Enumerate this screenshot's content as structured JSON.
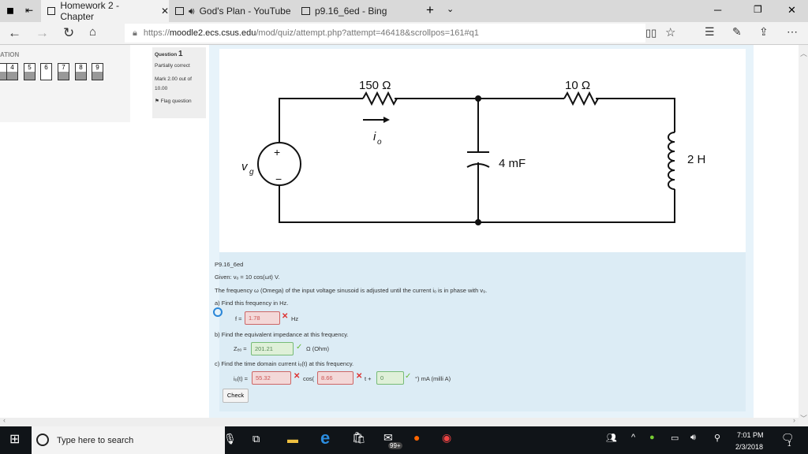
{
  "browser": {
    "tabs": [
      {
        "label": "Homework 2 - Chapter",
        "active": true
      },
      {
        "label": "God's Plan - YouTube",
        "audio": true
      },
      {
        "label": "p9.16_6ed - Bing"
      }
    ],
    "url_prefix": "https://",
    "url_host": "moodle2.ecs.csus.edu",
    "url_path": "/mod/quiz/attempt.php?attempt=46418&scrollpos=161#q1"
  },
  "nav": {
    "heading": "ATION",
    "buttons": [
      "4",
      "5",
      "6",
      "7",
      "8",
      "9"
    ]
  },
  "question_info": {
    "question_label": "Question",
    "question_number": "1",
    "status": "Partially correct",
    "mark": "Mark 2.00 out of 10.00",
    "flag": "Flag question"
  },
  "circuit": {
    "r1": "150 Ω",
    "r2": "10 Ω",
    "cap": "4 mF",
    "ind": "2 H",
    "source": "v",
    "source_sub": "g",
    "current": "i",
    "current_sub": "o",
    "plus": "+",
    "minus": "−"
  },
  "question": {
    "title": "P9.16_6ed",
    "given": "Given:  vₒ = 10 cos(ωt) V.",
    "statement": "The frequency ω (Omega) of the input voltage sinusoid is adjusted until the current iₒ is in phase with v₉.",
    "a_label": "a) Find this frequency in Hz.",
    "a_prefix": "f =",
    "a_value": "1.78",
    "a_unit": "Hz",
    "b_label": "b) Find the equivalent impedance at this frequency.",
    "b_prefix": "Zₑₒ =",
    "b_value": "201.21",
    "b_unit": "Ω (Ohm)",
    "c_label": "c) Find the time domain current iₒ(t) at this frequency.",
    "c_prefix": "iₒ(t) =",
    "c_amp": "55.32",
    "c_cos": "cos(",
    "c_freq": "8.66",
    "c_t": "t +",
    "c_phase": "0",
    "c_unit": "°) mA  (milli A)",
    "check": "Check"
  },
  "taskbar": {
    "search_placeholder": "Type here to search",
    "time": "7:01 PM",
    "date": "2/3/2018",
    "notif": "1",
    "badge": "99+"
  },
  "colors": {
    "wrong": "#f3d8d8",
    "right": "#dff0d8",
    "panel": "#dcecf5"
  }
}
